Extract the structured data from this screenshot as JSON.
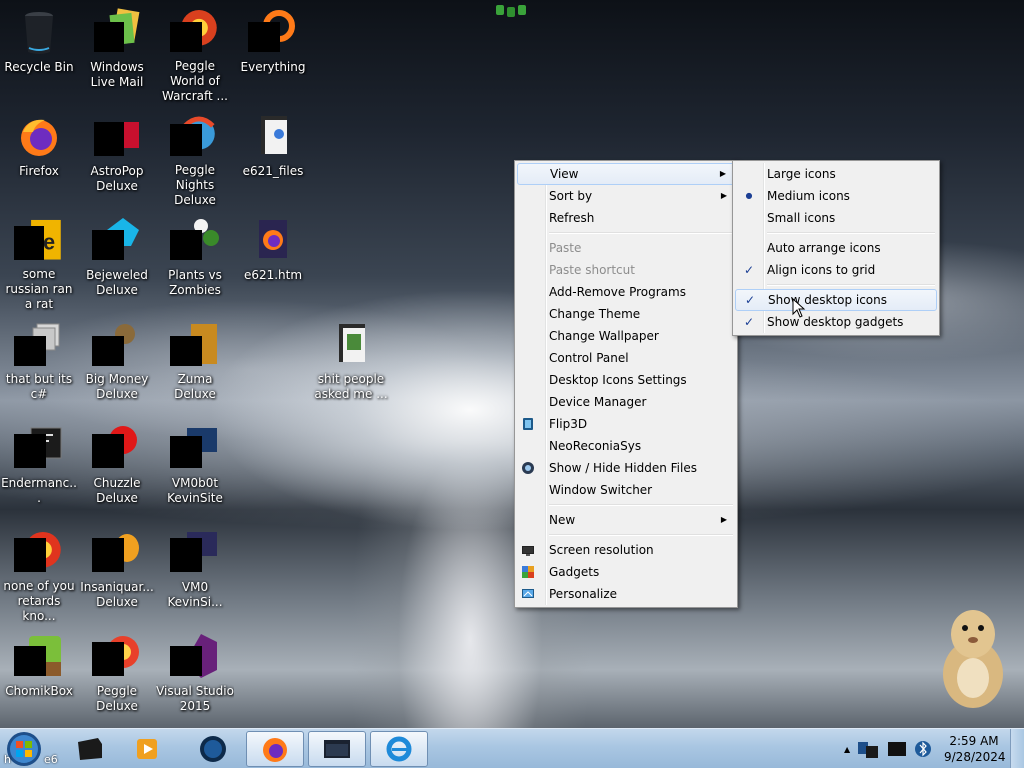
{
  "desktop": {
    "icons": [
      {
        "label": "Recycle Bin"
      },
      {
        "label": "Windows Live Mail"
      },
      {
        "label": "Peggle World of Warcraft ..."
      },
      {
        "label": "Everything"
      },
      {
        "label": "Firefox"
      },
      {
        "label": "AstroPop Deluxe"
      },
      {
        "label": "Peggle Nights Deluxe"
      },
      {
        "label": "e621_files"
      },
      {
        "label": "some russian ran a rat"
      },
      {
        "label": "Bejeweled Deluxe"
      },
      {
        "label": "Plants vs Zombies"
      },
      {
        "label": "e621.htm"
      },
      {
        "label": "that but its c#"
      },
      {
        "label": "Big Money Deluxe"
      },
      {
        "label": "Zuma Deluxe"
      },
      {
        "label": "shit people asked me ..."
      },
      {
        "label": "Endermanc..."
      },
      {
        "label": "Chuzzle Deluxe"
      },
      {
        "label": "VM0b0t KevinSite"
      },
      {
        "label": "none of you retards kno..."
      },
      {
        "label": "Insaniquar... Deluxe"
      },
      {
        "label": "VM0 KevinSi..."
      },
      {
        "label": "ChomikBox"
      },
      {
        "label": "Peggle Deluxe"
      },
      {
        "label": "Visual Studio 2015"
      }
    ]
  },
  "context_menu": {
    "items": [
      {
        "label": "View"
      },
      {
        "label": "Sort by"
      },
      {
        "label": "Refresh"
      },
      {
        "label": "Paste"
      },
      {
        "label": "Paste shortcut"
      },
      {
        "label": "Add-Remove Programs"
      },
      {
        "label": "Change Theme"
      },
      {
        "label": "Change Wallpaper"
      },
      {
        "label": "Control Panel"
      },
      {
        "label": "Desktop Icons Settings"
      },
      {
        "label": "Device Manager"
      },
      {
        "label": "Flip3D"
      },
      {
        "label": "NeoReconiaSys"
      },
      {
        "label": "Show / Hide Hidden Files"
      },
      {
        "label": "Window Switcher"
      },
      {
        "label": "New"
      },
      {
        "label": "Screen resolution"
      },
      {
        "label": "Gadgets"
      },
      {
        "label": "Personalize"
      }
    ]
  },
  "view_submenu": {
    "items": [
      {
        "label": "Large icons"
      },
      {
        "label": "Medium icons"
      },
      {
        "label": "Small icons"
      },
      {
        "label": "Auto arrange icons"
      },
      {
        "label": "Align icons to grid"
      },
      {
        "label": "Show desktop icons"
      },
      {
        "label": "Show desktop gadgets"
      }
    ],
    "checkmark": "✓",
    "bullet": "●"
  },
  "taskbar": {
    "start_text": "h",
    "start_suffix": "e6",
    "clock": {
      "time": "2:59 AM",
      "date": "9/28/2024"
    },
    "tray_arrow": "▲"
  },
  "colors": {
    "taskbar": "#a9c6e2",
    "menu_bg": "#f0f0f0",
    "menu_hover": "#aecff7",
    "check": "#1c3f94"
  }
}
